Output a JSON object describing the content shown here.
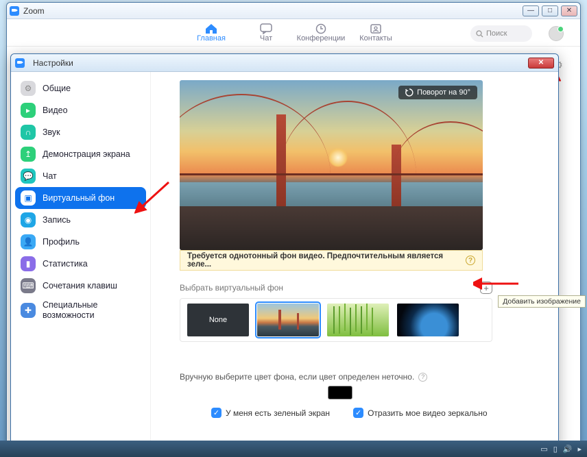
{
  "zoom": {
    "title": "Zoom",
    "nav": {
      "home": "Главная",
      "chat": "Чат",
      "conf": "Конференции",
      "contacts": "Контакты"
    },
    "search_placeholder": "Поиск"
  },
  "settings": {
    "title": "Настройки",
    "sidebar": {
      "general": "Общие",
      "video": "Видео",
      "audio": "Звук",
      "share": "Демонстрация экрана",
      "chat": "Чат",
      "vbg": "Виртуальный фон",
      "record": "Запись",
      "profile": "Профиль",
      "stats": "Статистика",
      "shortcuts": "Сочетания клавиш",
      "access": "Специальные возможности"
    },
    "rotate_label": "Поворот на 90°",
    "warning": "Требуется однотонный фон видео. Предпочтительным является зеле...",
    "choose_label": "Выбрать виртуальный фон",
    "add_tooltip": "Добавить изображение",
    "thumbs": {
      "none": "None"
    },
    "manual_label": "Вручную выберите цвет фона, если цвет определен неточно.",
    "green_screen": "У меня есть зеленый экран",
    "mirror": "Отразить мое видео зеркально"
  }
}
